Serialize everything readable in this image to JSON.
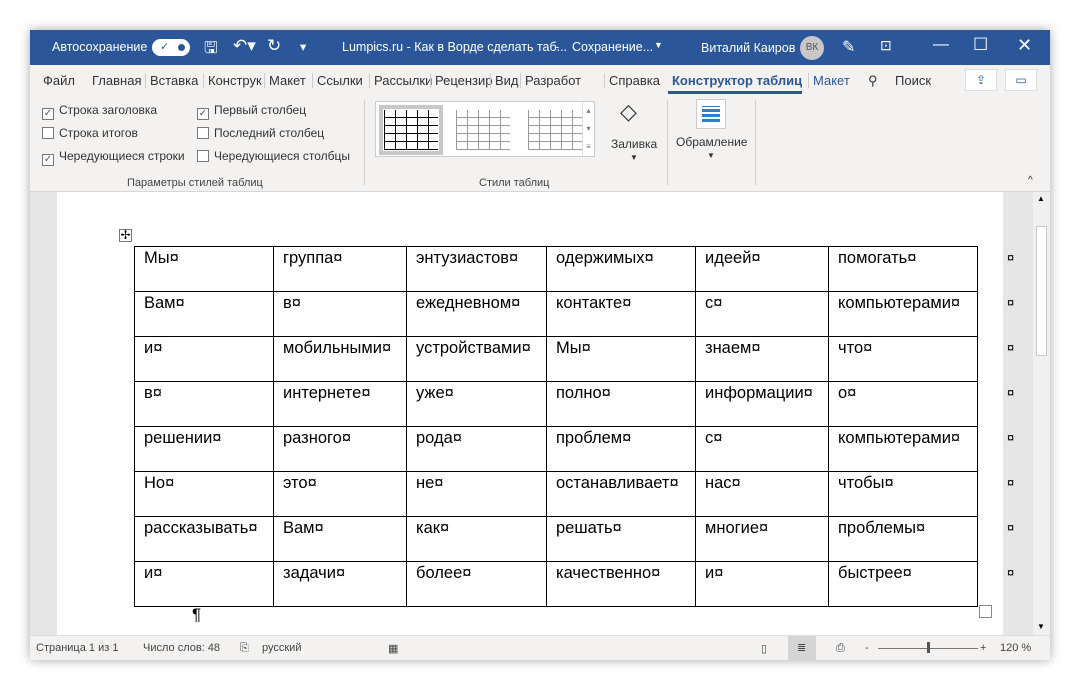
{
  "titlebar": {
    "autosave_label": "Автосохранение",
    "doc_title": "Lumpics.ru - Как в Ворде сделать таб...",
    "save_status": "Сохранение...",
    "user_name": "Виталий Каиров",
    "avatar_initials": "ВК"
  },
  "tabs": [
    "Файл",
    "Главная",
    "Вставка",
    "Конструк",
    "Макет",
    "Ссылки",
    "Рассылки",
    "Рецензир",
    "Вид",
    "Разработ",
    "Справка",
    "Конструктор таблиц",
    "Макет"
  ],
  "search_label": "Поиск",
  "ribbon": {
    "style_options": [
      {
        "label": "Строка заголовка",
        "checked": true
      },
      {
        "label": "Строка итогов",
        "checked": false
      },
      {
        "label": "Чередующиеся строки",
        "checked": true
      },
      {
        "label": "Первый столбец",
        "checked": true
      },
      {
        "label": "Последний столбец",
        "checked": false
      },
      {
        "label": "Чередующиеся столбцы",
        "checked": false
      }
    ],
    "group1_label": "Параметры стилей таблиц",
    "group2_label": "Стили таблиц",
    "shading_label": "Заливка",
    "borders_label": "Обрамление"
  },
  "table": {
    "rows": [
      [
        "Мы¤",
        "группа¤",
        "энтузиастов¤",
        "одержимых¤",
        "идеей¤",
        "помогать¤"
      ],
      [
        "Вам¤",
        "в¤",
        "ежедневном¤",
        "контакте¤",
        "с¤",
        "компьютерами¤"
      ],
      [
        "и¤",
        "мобильными¤",
        "устройствами¤",
        "Мы¤",
        "знаем¤",
        "что¤"
      ],
      [
        "в¤",
        "интернете¤",
        "уже¤",
        "полно¤",
        "информации¤",
        "о¤"
      ],
      [
        "решении¤",
        "разного¤",
        "рода¤",
        "проблем¤",
        "с¤",
        "компьютерами¤"
      ],
      [
        "Но¤",
        "это¤",
        "не¤",
        "останавливает¤",
        "нас¤",
        "чтобы¤"
      ],
      [
        "рассказывать¤",
        "Вам¤",
        "как¤",
        "решать¤",
        "многие¤",
        "проблемы¤"
      ],
      [
        "и¤",
        "задачи¤",
        "более¤",
        "качественно¤",
        "и¤",
        "быстрее¤"
      ]
    ],
    "row_end_mark": "¤",
    "paragraph_mark": "¶"
  },
  "status": {
    "page": "Страница 1 из 1",
    "words": "Число слов: 48",
    "language": "русский",
    "zoom": "120 %"
  }
}
